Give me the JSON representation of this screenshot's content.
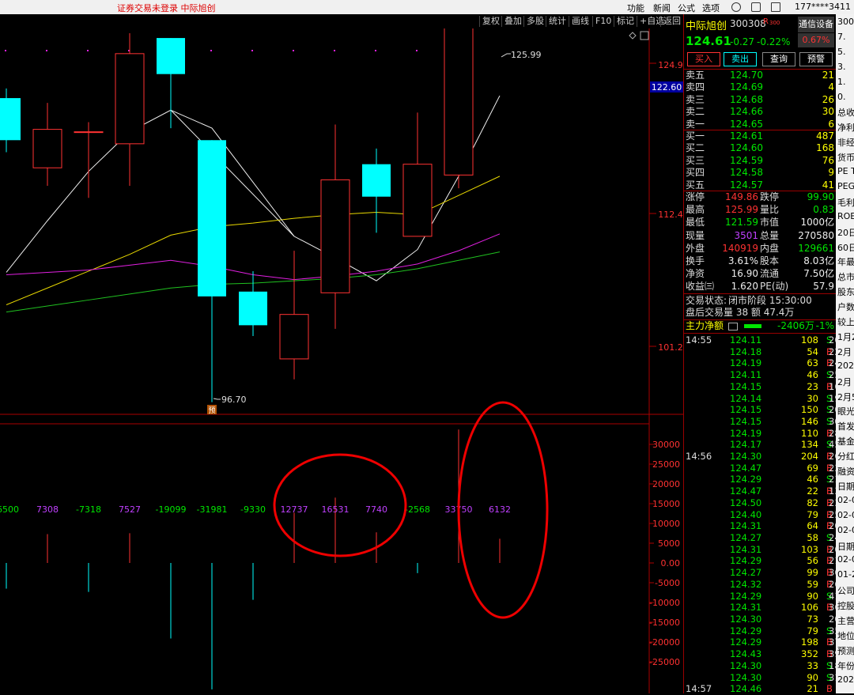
{
  "topbar": {
    "title": "证券交易未登录  中际旭创",
    "menu": [
      "功能",
      "新闻",
      "公式",
      "选项"
    ],
    "phone": "177****3411"
  },
  "toolbar": {
    "buttons": [
      "复权",
      "叠加",
      "多股",
      "统计",
      "画线",
      "F10",
      "标记",
      "+自选",
      "返回"
    ]
  },
  "stock": {
    "name": "中际旭创",
    "code": "300308",
    "market_tag": "R",
    "market_sub": "300",
    "sector_button": "通信设备",
    "sector_change": "0.67%",
    "price": "124.61",
    "change": "-0.27",
    "change_pct": "-0.22%",
    "trade_buttons": [
      "买入",
      "卖出",
      "查询",
      "预警"
    ]
  },
  "order_book": {
    "asks": [
      {
        "label": "卖五",
        "price": "124.70",
        "vol": "21"
      },
      {
        "label": "卖四",
        "price": "124.69",
        "vol": "4"
      },
      {
        "label": "卖三",
        "price": "124.68",
        "vol": "26"
      },
      {
        "label": "卖二",
        "price": "124.66",
        "vol": "30"
      },
      {
        "label": "卖一",
        "price": "124.65",
        "vol": "6"
      }
    ],
    "bids": [
      {
        "label": "买一",
        "price": "124.61",
        "vol": "487"
      },
      {
        "label": "买二",
        "price": "124.60",
        "vol": "168"
      },
      {
        "label": "买三",
        "price": "124.59",
        "vol": "76"
      },
      {
        "label": "买四",
        "price": "124.58",
        "vol": "9"
      },
      {
        "label": "买五",
        "price": "124.57",
        "vol": "41"
      }
    ]
  },
  "stats": [
    {
      "l1": "涨停",
      "v1": "149.86",
      "c1": "red",
      "l2": "跌停",
      "v2": "99.90",
      "c2": "green"
    },
    {
      "l1": "最高",
      "v1": "125.99",
      "c1": "red",
      "l2": "量比",
      "v2": "0.83",
      "c2": "green"
    },
    {
      "l1": "最低",
      "v1": "121.59",
      "c1": "green",
      "l2": "市值",
      "v2": "1000亿",
      "c2": "white"
    },
    {
      "l1": "现量",
      "v1": "3501",
      "c1": "purple",
      "l2": "总量",
      "v2": "270580",
      "c2": "white"
    },
    {
      "l1": "外盘",
      "v1": "140919",
      "c1": "red",
      "l2": "内盘",
      "v2": "129661",
      "c2": "green"
    },
    {
      "l1": "换手",
      "v1": "3.61%",
      "c1": "white",
      "l2": "股本",
      "v2": "8.03亿",
      "c2": "white"
    },
    {
      "l1": "净资",
      "v1": "16.90",
      "c1": "white",
      "l2": "流通",
      "v2": "7.50亿",
      "c2": "white"
    },
    {
      "l1": "收益㈢",
      "v1": "1.620",
      "c1": "white",
      "l2": "PE(动)",
      "v2": "57.9",
      "c2": "white"
    }
  ],
  "trade_status": {
    "line1_label": "交易状态:",
    "line1_value": "闭市阶段 15:30:00",
    "line2": "盘后交易量 38 额 47.4万"
  },
  "main_flow": {
    "label": "主力净额",
    "value": "-2406万",
    "pct": "-1%"
  },
  "ticks": [
    {
      "time": "14:55",
      "price": "124.11",
      "vol": "108",
      "side": "S",
      "n": "20"
    },
    {
      "time": "",
      "price": "124.18",
      "vol": "54",
      "side": "B",
      "n": "22"
    },
    {
      "time": "",
      "price": "124.19",
      "vol": "63",
      "side": "B",
      "n": "24"
    },
    {
      "time": "",
      "price": "124.11",
      "vol": "46",
      "side": "S",
      "n": "25"
    },
    {
      "time": "",
      "price": "124.15",
      "vol": "23",
      "side": "B",
      "n": "16"
    },
    {
      "time": "",
      "price": "124.14",
      "vol": "30",
      "side": "S",
      "n": "19"
    },
    {
      "time": "",
      "price": "124.15",
      "vol": "150",
      "side": "S",
      "n": "20"
    },
    {
      "time": "",
      "price": "124.15",
      "vol": "146",
      "side": "S",
      "n": "30"
    },
    {
      "time": "",
      "price": "124.19",
      "vol": "110",
      "side": "B",
      "n": "28"
    },
    {
      "time": "",
      "price": "124.17",
      "vol": "134",
      "side": "S",
      "n": "45"
    },
    {
      "time": "14:56",
      "price": "124.30",
      "vol": "204",
      "side": "B",
      "n": "26"
    },
    {
      "time": "",
      "price": "124.47",
      "vol": "69",
      "side": "B",
      "n": "23"
    },
    {
      "time": "",
      "price": "124.29",
      "vol": "46",
      "side": "S",
      "n": "21"
    },
    {
      "time": "",
      "price": "124.47",
      "vol": "22",
      "side": "B",
      "n": "13"
    },
    {
      "time": "",
      "price": "124.50",
      "vol": "82",
      "side": "B",
      "n": "23"
    },
    {
      "time": "",
      "price": "124.40",
      "vol": "79",
      "side": "B",
      "n": "25"
    },
    {
      "time": "",
      "price": "124.31",
      "vol": "64",
      "side": "B",
      "n": "20"
    },
    {
      "time": "",
      "price": "124.27",
      "vol": "58",
      "side": "S",
      "n": "24"
    },
    {
      "time": "",
      "price": "124.31",
      "vol": "103",
      "side": "B",
      "n": "20"
    },
    {
      "time": "",
      "price": "124.29",
      "vol": "56",
      "side": "B",
      "n": "21"
    },
    {
      "time": "",
      "price": "124.27",
      "vol": "99",
      "side": "B",
      "n": "36"
    },
    {
      "time": "",
      "price": "124.32",
      "vol": "59",
      "side": "B",
      "n": "26"
    },
    {
      "time": "",
      "price": "124.29",
      "vol": "90",
      "side": "S",
      "n": "41"
    },
    {
      "time": "",
      "price": "124.31",
      "vol": "106",
      "side": "B",
      "n": "36"
    },
    {
      "time": "",
      "price": "124.30",
      "vol": "73",
      "side": "",
      "n": "20"
    },
    {
      "time": "",
      "price": "124.29",
      "vol": "79",
      "side": "S",
      "n": "35"
    },
    {
      "time": "",
      "price": "124.29",
      "vol": "198",
      "side": "B",
      "n": "37"
    },
    {
      "time": "",
      "price": "124.43",
      "vol": "352",
      "side": "B",
      "n": "39"
    },
    {
      "time": "",
      "price": "124.30",
      "vol": "33",
      "side": "S",
      "n": "18"
    },
    {
      "time": "",
      "price": "124.30",
      "vol": "90",
      "side": "S",
      "n": "31"
    },
    {
      "time": "14:57",
      "price": "124.46",
      "vol": "21",
      "side": "B",
      "n": ""
    }
  ],
  "far_right": {
    "items": [
      "300",
      "7.",
      "5.",
      "3.",
      "1.",
      "0.",
      "总收",
      "净利",
      "非经",
      "货币",
      "PE T",
      "PEG",
      "毛利",
      "ROE",
      "20日",
      "60日",
      "年最",
      "总市",
      "股东",
      "户数",
      "较上",
      "1月2",
      "2月",
      "202",
      "2月",
      "2月5",
      "眼光",
      "首发",
      "基金",
      "分红",
      "融资",
      "日期",
      "02-0",
      "02-0",
      "02-0",
      "日期",
      "02-0",
      "01-2",
      "公司",
      "控股",
      "主营",
      "地位",
      "预测",
      "年份",
      "202"
    ]
  },
  "chart_data": {
    "type": "candlestick",
    "price_axis_ticks": [
      "124.9",
      "112.4",
      "101.2"
    ],
    "current_price_label": "122.60",
    "high_marker": "125.99",
    "low_marker": "96.70",
    "low_marker_tag": "预",
    "candles": [
      {
        "open": 118.5,
        "close": 122.0,
        "high": 122.8,
        "low": 117.5,
        "dir": "down"
      },
      {
        "open": 116.2,
        "close": 119.4,
        "high": 121.6,
        "low": 114.7,
        "dir": "up"
      },
      {
        "open": 119.2,
        "close": 119.2,
        "high": 120.0,
        "low": 113.7,
        "dir": "up"
      },
      {
        "open": 118.2,
        "close": 125.7,
        "high": 127.4,
        "low": 114.7,
        "dir": "up"
      },
      {
        "open": 124.0,
        "close": 127.0,
        "high": 127.0,
        "low": 119.5,
        "dir": "down"
      },
      {
        "open": 118.5,
        "close": 105.5,
        "high": 118.5,
        "low": 96.7,
        "dir": "down"
      },
      {
        "open": 103.1,
        "close": 105.9,
        "high": 107.6,
        "low": 102.2,
        "dir": "down"
      },
      {
        "open": 100.3,
        "close": 104.0,
        "high": 109.3,
        "low": 98.6,
        "dir": "up"
      },
      {
        "open": 105.8,
        "close": 115.2,
        "high": 119.8,
        "low": 102.8,
        "dir": "up"
      },
      {
        "open": 113.8,
        "close": 116.5,
        "high": 117.8,
        "low": 110.8,
        "dir": "down"
      },
      {
        "open": 110.5,
        "close": 116.5,
        "high": 120.8,
        "low": 110.5,
        "dir": "up"
      },
      {
        "open": 115.6,
        "close": 133.9,
        "high": 133.9,
        "low": 114.5,
        "dir": "up"
      },
      {
        "open": 131.3,
        "close": 133.9,
        "high": 135.0,
        "low": 129.7,
        "dir": "up"
      }
    ],
    "ma_series": [
      {
        "color": "#f0f0f0",
        "values": [
          107.5,
          111.8,
          115.9,
          119.2,
          121.0,
          null,
          null,
          110.5,
          108.7,
          106.8,
          109.4,
          115.5,
          122.2
        ]
      },
      {
        "color": "#e8d800",
        "values": [
          104.8,
          106.2,
          107.6,
          109.0,
          110.6,
          111.3,
          111.6,
          112.0,
          112.3,
          112.5,
          112.3,
          113.9,
          115.5
        ]
      },
      {
        "color": "#e020e0",
        "values": [
          107.3,
          107.5,
          107.7,
          108.1,
          108.5,
          108.0,
          107.3,
          106.9,
          107.2,
          107.6,
          108.2,
          109.3,
          110.7
        ]
      },
      {
        "color": "#20c020",
        "values": [
          104.2,
          104.7,
          105.2,
          105.7,
          106.2,
          106.5,
          106.6,
          106.8,
          107.0,
          107.3,
          107.8,
          108.5,
          109.2
        ]
      }
    ],
    "indicator": {
      "axis_ticks": [
        "30000",
        "25000",
        "20000",
        "15000",
        "10000",
        "5000",
        "0.00",
        "-5000",
        "-10000",
        "-15000",
        "-20000",
        "-25000"
      ],
      "bar_labels": [
        "-6500",
        "7308",
        "-7318",
        "7527",
        "-19099",
        "-31981",
        "-9330",
        "12737",
        "16531",
        "7740",
        "-2568",
        "33750",
        "6132"
      ],
      "values": [
        -6500,
        7308,
        -7318,
        7527,
        -19099,
        -31981,
        -9330,
        12737,
        16531,
        7740,
        -2568,
        33750,
        6132
      ]
    }
  }
}
